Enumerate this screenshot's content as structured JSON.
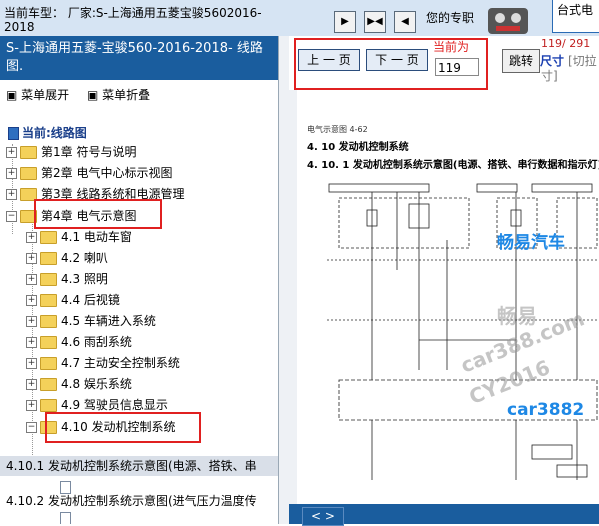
{
  "header": {
    "car_model_text": "当前车型： 厂家:S-上海通用五菱宝骏5602016-2018",
    "welcome_text": "您的专职",
    "logo_text": "台式电",
    "controls": [
      {
        "name": "play",
        "glyph": "▶"
      },
      {
        "name": "fit",
        "glyph": "▶◀"
      },
      {
        "name": "back",
        "glyph": "◀"
      }
    ]
  },
  "sidebar": {
    "doc_title": "S-上海通用五菱-宝骏560-2016-2018- 线路图.",
    "expand_label": "菜单展开",
    "collapse_label": "菜单折叠",
    "current_label": "当前:线路图",
    "chapters": [
      {
        "label": "第1章 符号与说明",
        "expanded": false
      },
      {
        "label": "第2章 电气中心标示视图",
        "expanded": false
      },
      {
        "label": "第3章 线路系统和电源管理",
        "expanded": false
      },
      {
        "label": "第4章 电气示意图",
        "expanded": true
      }
    ],
    "subsections": [
      "4.1 电动车窗",
      "4.2 喇叭",
      "4.3 照明",
      "4.4 后视镜",
      "4.5 车辆进入系统",
      "4.6 雨刮系统",
      "4.7 主动安全控制系统",
      "4.8 娱乐系统",
      "4.9 驾驶员信息显示",
      "4.10 发动机控制系统"
    ],
    "leaf_items": [
      {
        "label": "4.10.1 发动机控制系统示意图(电源、搭铁、串",
        "selected": true
      },
      {
        "label": "4.10.2 发动机控制系统示意图(进气压力温度传",
        "selected": false
      }
    ]
  },
  "toolbar": {
    "prev_label": "上 一 页",
    "next_label": "下 一 页",
    "current_page_label": "当前为",
    "page_value": "119",
    "jump_label": "跳转",
    "page_count": "119/ 291",
    "size_label": "尺寸",
    "size_option": "[切拉",
    "size_option_tail": "寸]"
  },
  "document": {
    "figure_caption": "电气示意图 4-62",
    "section_title": "4. 10 发动机控制系统",
    "subsection_title": "4. 10. 1 发动机控制系统示意图(电源、搭铁、串行数据和指示灯)",
    "watermarks": [
      "畅易汽车",
      "畅易",
      "car388.com",
      "CY2016",
      "car3882"
    ]
  },
  "bottom": {
    "nav_label": "< >"
  },
  "colors": {
    "header_blue": "#1a5d9e",
    "highlight_red": "#e02020",
    "top_strip": "#d6e4f3"
  }
}
